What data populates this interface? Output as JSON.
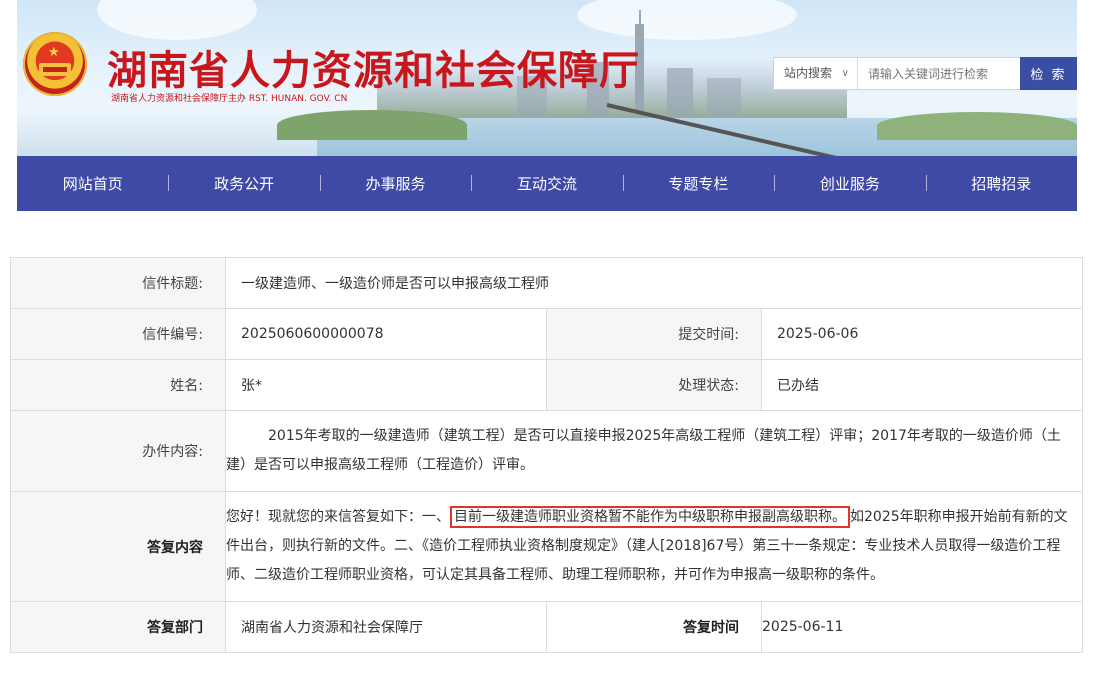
{
  "header": {
    "site_title": "湖南省人力资源和社会保障厅",
    "site_subtitle": "湖南省人力资源和社会保障厅主办   RST. HUNAN. GOV. CN",
    "search": {
      "scope_label": "站内搜索",
      "placeholder": "请输入关键词进行检索",
      "button_label": "检 索"
    }
  },
  "nav": {
    "items": [
      "网站首页",
      "政务公开",
      "办事服务",
      "互动交流",
      "专题专栏",
      "创业服务",
      "招聘招录"
    ]
  },
  "letter": {
    "title_label": "信件标题:",
    "title": "一级建造师、一级造价师是否可以申报高级工程师",
    "number_label": "信件编号:",
    "number": "2025060600000078",
    "submit_time_label": "提交时间:",
    "submit_time": "2025-06-06",
    "name_label": "姓名:",
    "name": "张*",
    "status_label": "处理状态:",
    "status": "已办结",
    "content_label": "办件内容:",
    "content": "2015年考取的一级建造师（建筑工程）是否可以直接申报2025年高级工程师（建筑工程）评审；2017年考取的一级造价师（土建）是否可以申报高级工程师（工程造价）评审。",
    "reply_label": "答复内容",
    "reply_before": "您好！现就您的来信答复如下：一、",
    "reply_highlight": "目前一级建造师职业资格暂不能作为中级职称申报副高级职称。",
    "reply_after": "如2025年职称申报开始前有新的文件出台，则执行新的文件。二、《造价工程师执业资格制度规定》（建人[2018]67号）第三十一条规定：专业技术人员取得一级造价工程师、二级造价工程师职业资格，可认定其具备工程师、助理工程师职称，并可作为申报高一级职称的条件。",
    "dept_label": "答复部门",
    "dept": "湖南省人力资源和社会保障厅",
    "reply_time_label": "答复时间",
    "reply_time": "2025-06-11"
  },
  "colors": {
    "title_red": "#c8161d",
    "nav_blue": "#3f4aa6",
    "highlight_red": "#e0342a"
  }
}
